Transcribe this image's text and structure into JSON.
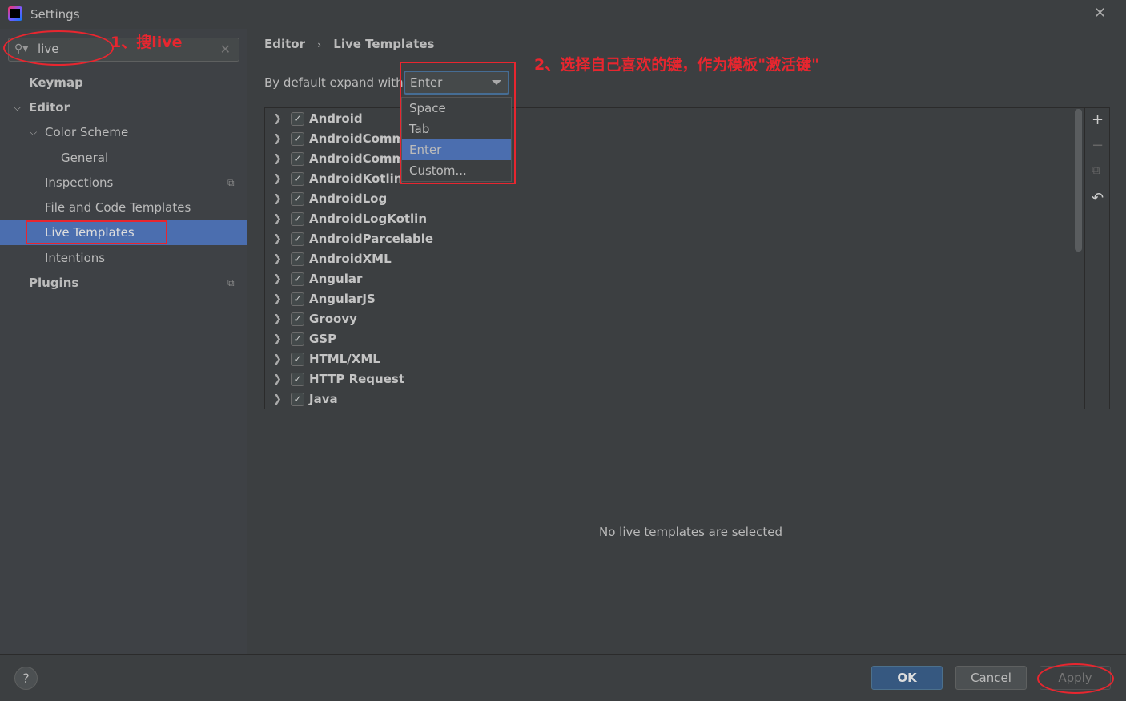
{
  "window": {
    "title": "Settings",
    "close_icon": "close-icon"
  },
  "search": {
    "value": "live"
  },
  "sidebar": {
    "items": [
      {
        "label": "Keymap",
        "bold": true
      },
      {
        "label": "Editor",
        "bold": true,
        "expanded": true
      },
      {
        "label": "Color Scheme",
        "expanded": true
      },
      {
        "label": "General"
      },
      {
        "label": "Inspections"
      },
      {
        "label": "File and Code Templates"
      },
      {
        "label": "Live Templates",
        "selected": true
      },
      {
        "label": "Intentions"
      },
      {
        "label": "Plugins",
        "bold": true
      }
    ]
  },
  "annotations": {
    "step1": "1、搜live",
    "step2": "2、选择自己喜欢的键，作为模板\"激活键\"",
    "color": "#e8262f"
  },
  "breadcrumb": {
    "parent": "Editor",
    "sep": "›",
    "current": "Live Templates"
  },
  "expand": {
    "label": "By default expand with",
    "value": "Enter",
    "options": [
      "Space",
      "Tab",
      "Enter",
      "Custom..."
    ]
  },
  "templates": [
    "Android",
    "AndroidComments",
    "AndroidComments",
    "AndroidKotlin",
    "AndroidLog",
    "AndroidLogKotlin",
    "AndroidParcelable",
    "AndroidXML",
    "Angular",
    "AngularJS",
    "Groovy",
    "GSP",
    "HTML/XML",
    "HTTP Request",
    "Java"
  ],
  "empty_text": "No live templates are selected",
  "footer": {
    "help": "?",
    "ok": "OK",
    "cancel": "Cancel",
    "apply": "Apply"
  },
  "colors": {
    "selection": "#4b6eaf",
    "background": "#3c3f41",
    "ok_button": "#365880"
  }
}
